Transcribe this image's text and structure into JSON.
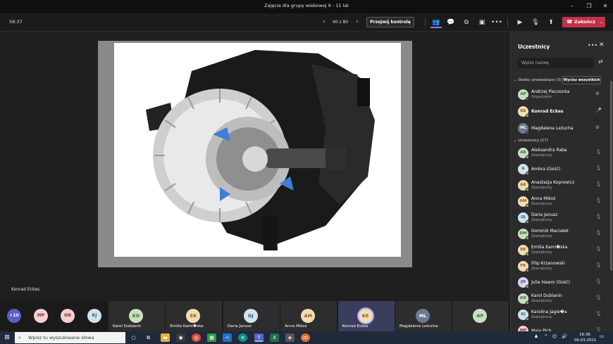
{
  "window": {
    "title": "Zajęcia dla grupy wiekowej 9 - 11 lat"
  },
  "toolbar": {
    "timer": "58:37",
    "page_indicator": "40 z 80",
    "take_control_label": "Przejmij kontrolę",
    "end_label": "Zakończ"
  },
  "stage": {
    "presenter_name": "Konrad Eckes"
  },
  "panel": {
    "title": "Uczestnicy",
    "search_placeholder": "Wpisz nazwę",
    "presenters_header": "Osoby prowadzące (3)",
    "mute_all_label": "Wycisz wszystkich",
    "attendees_header": "Uczestnicy (17)",
    "presenters": [
      {
        "initials": "AP",
        "name": "Andrzej Pieczonka",
        "role": "Organizator",
        "color": "#c7e0c1",
        "fg": "#3d6b34"
      },
      {
        "initials": "KE",
        "name": "Konrad Eckes",
        "role": "",
        "color": "#f3dcb4",
        "fg": "#8a5b12"
      },
      {
        "initials": "ML",
        "name": "Magdalena Leżucha",
        "role": "",
        "color": "#6b7b8f",
        "fg": "#ffffff"
      }
    ],
    "attendees": [
      {
        "initials": "AR",
        "name": "Aleksandra Raba",
        "role": "Zewnętrzny",
        "color": "#c7e0c1",
        "fg": "#3d6b34"
      },
      {
        "initials": "A",
        "name": "Ambra (Gość)",
        "role": "",
        "color": "#cfe3e8",
        "fg": "#2e6470"
      },
      {
        "initials": "AK",
        "name": "Anastazja Koprowicz",
        "role": "Zewnętrzny",
        "color": "#f3dcb4",
        "fg": "#8a5b12"
      },
      {
        "initials": "AM",
        "name": "Anna Mikoś",
        "role": "Zewnętrzny",
        "color": "#f3dcb4",
        "fg": "#8a5b12"
      },
      {
        "initials": "DJ",
        "name": "Daria Janusz",
        "role": "Zewnętrzny",
        "color": "#cfe3f2",
        "fg": "#2c5e86"
      },
      {
        "initials": "DM",
        "name": "Dominik Maciałek",
        "role": "Zewnętrzny",
        "color": "#c7e0c1",
        "fg": "#3d6b34"
      },
      {
        "initials": "EK",
        "name": "Emilia Kami�ska",
        "role": "Zewnętrzny",
        "color": "#f3dcb4",
        "fg": "#8a5b12"
      },
      {
        "initials": "FK",
        "name": "Filip Krzanowski",
        "role": "Zewnętrzny",
        "color": "#f3dcb4",
        "fg": "#8a5b12"
      },
      {
        "initials": "JH",
        "name": "Julia Hawro (Gość)",
        "role": "",
        "color": "#d8d5ef",
        "fg": "#4a4587"
      },
      {
        "initials": "KD",
        "name": "Karol Dublanin",
        "role": "Zewnętrzny",
        "color": "#c7e0c1",
        "fg": "#3d6b34"
      },
      {
        "initials": "KJ",
        "name": "Karolina Jagie�a",
        "role": "Zewnętrzny",
        "color": "#cfe3e8",
        "fg": "#2e6470"
      },
      {
        "initials": "MP",
        "name": "Maja Pich",
        "role": "",
        "color": "#f3d0d3",
        "fg": "#8a2f3a"
      }
    ]
  },
  "gallery": {
    "overflow_label": "+10",
    "avatars": [
      {
        "initials": "MP",
        "color": "#f3d0d3",
        "fg": "#8a2f3a"
      },
      {
        "initials": "ON",
        "color": "#f3d0d3",
        "fg": "#8a2f3a"
      },
      {
        "initials": "KJ",
        "color": "#cfe3e8",
        "fg": "#2e6470"
      }
    ],
    "tiles": [
      {
        "initials": "KD",
        "name": "Karol Dublanin",
        "color": "#c7e0c1",
        "fg": "#3d6b34"
      },
      {
        "initials": "EK",
        "name": "Emilia Kami�ska",
        "color": "#f3dcb4",
        "fg": "#8a5b12"
      },
      {
        "initials": "DJ",
        "name": "Daria Janusz",
        "color": "#cfe3f2",
        "fg": "#2c5e86"
      },
      {
        "initials": "AM",
        "name": "Anna Mikoś",
        "color": "#f3dcb4",
        "fg": "#8a5b12"
      },
      {
        "initials": "KE",
        "name": "Konrad Eckes",
        "color": "#f3dcb4",
        "fg": "#8a5b12"
      },
      {
        "initials": "ML",
        "name": "Magdalena Leżucha",
        "color": "#6b7b8f",
        "fg": "#ffffff"
      },
      {
        "initials": "AP",
        "name": "",
        "color": "#c7e0c1",
        "fg": "#3d6b34"
      }
    ]
  },
  "taskbar": {
    "search_placeholder": "Wpisz tu wyszukiwane słowa",
    "time": "19:36",
    "date": "06.03.2021"
  }
}
